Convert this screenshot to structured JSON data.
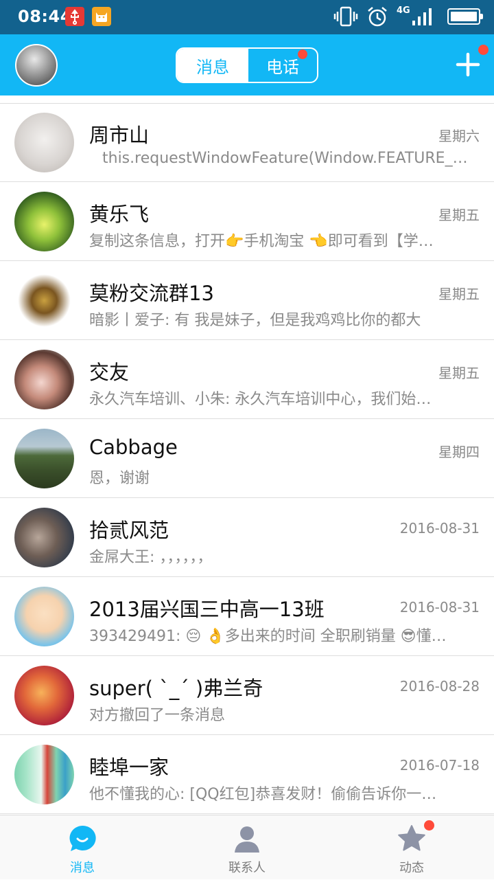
{
  "status_bar": {
    "time": "08:44",
    "network": "4G",
    "icons": [
      "usb-icon",
      "cat-app-icon",
      "vibrate-icon",
      "alarm-icon",
      "signal-icon",
      "battery-icon"
    ]
  },
  "header": {
    "tabs": [
      {
        "label": "消息",
        "selected": true
      },
      {
        "label": "电话",
        "selected": false,
        "badge": true
      }
    ],
    "add_badge": true,
    "colors": {
      "accent": "#12b7f5",
      "status_bar": "#12628e",
      "badge": "#ff4b3a"
    }
  },
  "conversations": [
    {
      "name": "周市山",
      "time": "星期六",
      "message": "this.requestWindowFeature(Window.FEATURE_N…"
    },
    {
      "name": "黄乐飞",
      "time": "星期五",
      "message": "复制这条信息，打开👉手机淘宝 👈即可看到【学…"
    },
    {
      "name": "莫粉交流群13",
      "time": "星期五",
      "message": "暗影丨爱子: 有 我是妹子，但是我鸡鸡比你的都大"
    },
    {
      "name": "交友",
      "time": "星期五",
      "message": "永久汽车培训、小朱: 永久汽车培训中心，我们始…"
    },
    {
      "name": "Cabbage",
      "time": "星期四",
      "message": "恩，谢谢"
    },
    {
      "name": "拾贰风范",
      "time": "2016-08-31",
      "message": "金屌大王: ，，，，，，"
    },
    {
      "name": "2013届兴国三中高一13班",
      "time": "2016-08-31",
      "message": "393429491: 😔 👌多出来的时间 全职刷销量 😎懂…"
    },
    {
      "name": "super( ˋ_ˊ )弗兰奇",
      "time": "2016-08-28",
      "message": "对方撤回了一条消息"
    },
    {
      "name": "睦埠一家",
      "time": "2016-07-18",
      "message": "他不懂我的心: [QQ红包]恭喜发财！偷偷告诉你一…"
    }
  ],
  "tabbar": {
    "items": [
      {
        "label": "消息",
        "icon": "chat-bubble-icon",
        "active": true
      },
      {
        "label": "联系人",
        "icon": "contact-person-icon",
        "active": false
      },
      {
        "label": "动态",
        "icon": "star-icon",
        "active": false,
        "badge": true
      }
    ]
  }
}
